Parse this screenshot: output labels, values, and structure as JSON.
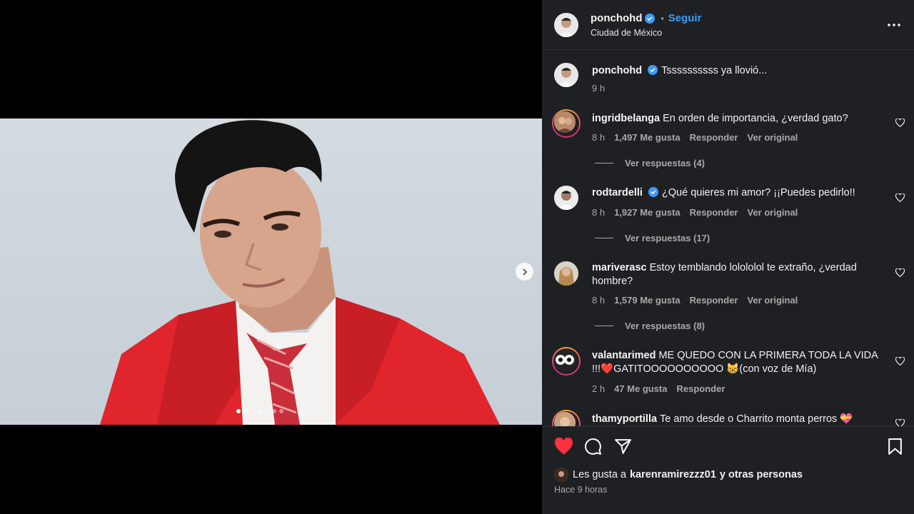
{
  "post": {
    "author": "ponchohd",
    "follow_label": "Seguir",
    "separator": "•",
    "location": "Ciudad de México",
    "caption_user": "ponchohd",
    "caption_text": "Tssssssssss ya llovió...",
    "caption_time": "9 h",
    "carousel": {
      "current": 1,
      "total": 6
    }
  },
  "comments": [
    {
      "user": "ingridbelanga",
      "verified": false,
      "text": "En orden de importancia, ¿verdad gato?",
      "time": "8 h",
      "likes": "1,497 Me gusta",
      "reply": "Responder",
      "original": "Ver original",
      "replies": "Ver respuestas (4)"
    },
    {
      "user": "rodtardelli",
      "verified": true,
      "text": "¿Qué quieres mi amor? ¡¡Puedes pedirlo!!",
      "time": "8 h",
      "likes": "1,927 Me gusta",
      "reply": "Responder",
      "original": "Ver original",
      "replies": "Ver respuestas (17)"
    },
    {
      "user": "mariverasc",
      "verified": false,
      "text": "Estoy temblando lolololol te extraño, ¿verdad hombre?",
      "time": "8 h",
      "likes": "1,579 Me gusta",
      "reply": "Responder",
      "original": "Ver original",
      "replies": "Ver respuestas (8)"
    },
    {
      "user": "valantarimed",
      "verified": false,
      "text": "ME QUEDO CON LA PRIMERA TODA LA VIDA !!!❤️GATITOOOOOOOOOO 😸(con voz de Mía)",
      "time": "2 h",
      "likes": "47 Me gusta",
      "reply": "Responder"
    },
    {
      "user": "thamyportilla",
      "verified": false,
      "text": "Te amo desde o Charrito monta perros 💝"
    }
  ],
  "footer": {
    "likes_prefix": "Les gusta a",
    "likes_user": "karenramirezzz01",
    "likes_suffix": "y otras personas",
    "time": "Hace 9 horas"
  },
  "icons": {
    "like": "heart-icon",
    "comment": "comment-icon",
    "share": "send-icon",
    "save": "bookmark-icon",
    "more": "more-options-icon",
    "next": "chevron-right-icon",
    "verified": "verified-badge-icon"
  },
  "colors": {
    "panel_bg": "#1f2024",
    "accent": "#3d9bf7",
    "liked": "#ff3040",
    "muted_text": "#a8a8a8"
  }
}
